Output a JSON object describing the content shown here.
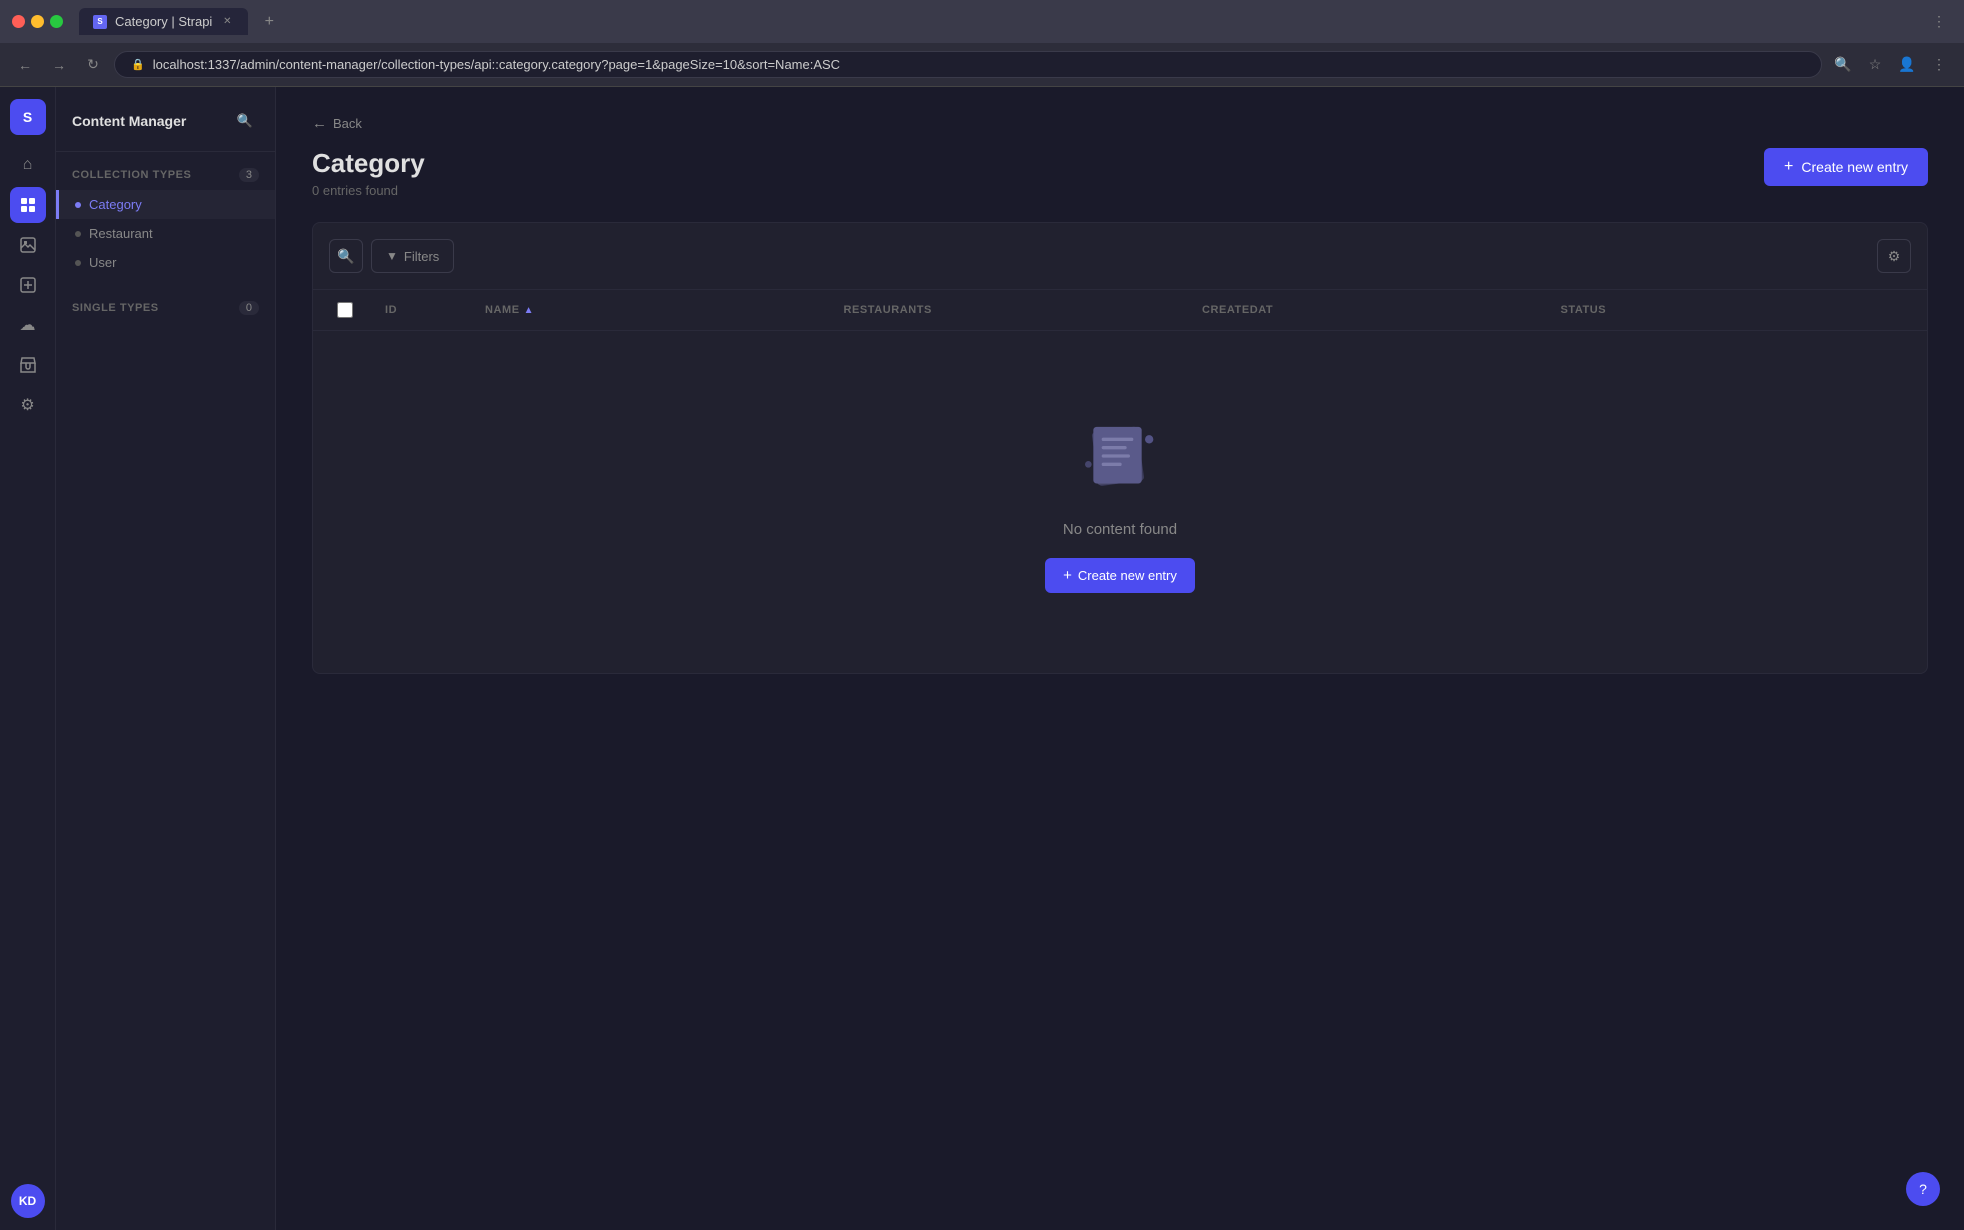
{
  "browser": {
    "tab_title": "Category | Strapi",
    "url": "localhost:1337/admin/content-manager/collection-types/api::category.category?page=1&pageSize=10&sort=Name:ASC",
    "tab_add_label": "+",
    "nav_back": "←",
    "nav_forward": "→",
    "nav_refresh": "↻",
    "nav_more": "⋮"
  },
  "icon_sidebar": {
    "logo_text": "S",
    "nav_icons": [
      {
        "name": "home-icon",
        "symbol": "⌂",
        "active": false
      },
      {
        "name": "content-manager-icon",
        "symbol": "✦",
        "active": true
      },
      {
        "name": "media-icon",
        "symbol": "▣",
        "active": false
      },
      {
        "name": "content-builder-icon",
        "symbol": "⬜",
        "active": false
      },
      {
        "name": "marketplace-icon",
        "symbol": "☁",
        "active": false
      },
      {
        "name": "shop-icon",
        "symbol": "🛒",
        "active": false
      },
      {
        "name": "settings-icon",
        "symbol": "⚙",
        "active": false
      }
    ],
    "user_initials": "KD",
    "help_symbol": "?"
  },
  "nav_sidebar": {
    "title": "Content Manager",
    "search_tooltip": "Search",
    "collection_types_label": "COLLECTION TYPES",
    "collection_types_count": "3",
    "collection_items": [
      {
        "label": "Category",
        "active": true
      },
      {
        "label": "Restaurant",
        "active": false
      },
      {
        "label": "User",
        "active": false
      }
    ],
    "single_types_label": "SINGLE TYPES",
    "single_types_count": "0"
  },
  "main": {
    "back_label": "Back",
    "page_title": "Category",
    "entries_found": "0 entries found",
    "create_btn_label": "Create new entry",
    "filters_btn_label": "Filters",
    "table": {
      "columns": [
        {
          "key": "checkbox",
          "label": ""
        },
        {
          "key": "id",
          "label": "ID"
        },
        {
          "key": "name",
          "label": "NAME",
          "sort": "ASC"
        },
        {
          "key": "restaurants",
          "label": "RESTAURANTS"
        },
        {
          "key": "createdat",
          "label": "CREATEDAT"
        },
        {
          "key": "status",
          "label": "STATUS"
        }
      ]
    },
    "empty_state": {
      "title": "No content found",
      "create_btn_label": "Create new entry"
    }
  }
}
